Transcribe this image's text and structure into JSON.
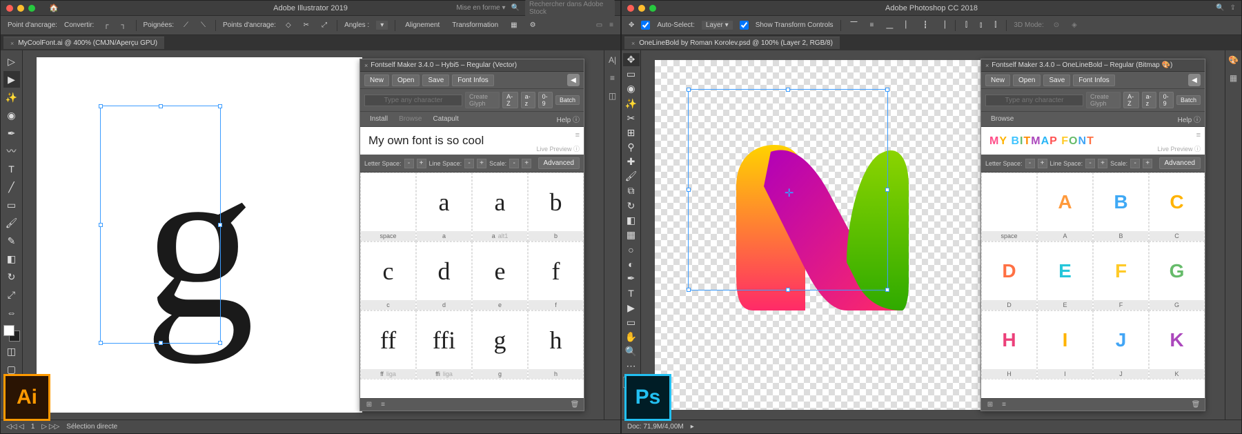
{
  "ai": {
    "app_title": "Adobe Illustrator 2019",
    "layout_label": "Mise en forme ▾",
    "search_placeholder": "Rechercher dans Adobe Stock",
    "options": {
      "anchor": "Point d'ancrage:",
      "convert": "Convertir:",
      "handles": "Poignées:",
      "anchor2": "Points d'ancrage:",
      "angles": "Angles :",
      "align": "Alignement",
      "transform": "Transformation"
    },
    "doc_tab": "MyCoolFont.ai @ 400% (CMJN/Aperçu GPU)",
    "big_glyph": "g",
    "status": {
      "selection": "Sélection directe",
      "page": "1"
    },
    "badge": "Ai"
  },
  "ps": {
    "app_title": "Adobe Photoshop CC 2018",
    "options": {
      "auto_select": "Auto-Select:",
      "layer": "Layer",
      "show_transform": "Show Transform Controls",
      "mode3d": "3D Mode:"
    },
    "doc_tab": "OneLineBold by Roman Korolev.psd @ 100% (Layer 2, RGB/8)",
    "status": {
      "doc": "Doc: 71,9M/4,00M"
    },
    "badge": "Ps"
  },
  "fontself_ai": {
    "title": "Fontself Maker 3.4.0 – Hybi5 – Regular (Vector)",
    "new": "New",
    "open": "Open",
    "save": "Save",
    "info": "Font Infos",
    "type_ph": "Type any character",
    "create": "Create Glyph",
    "az_u": "A-Z",
    "az_l": "a-z",
    "nums": "0-9",
    "batch": "Batch",
    "install": "Install",
    "browse": "Browse",
    "catapult": "Catapult",
    "help": "Help ⓘ",
    "preview": "My own font is so cool",
    "live": "Live Preview ⓘ",
    "letter": "Letter Space:",
    "line": "Line Space:",
    "scale": "Scale:",
    "adv": "Advanced",
    "rows": [
      [
        {
          "g": "",
          "l": "space"
        },
        {
          "g": "a",
          "l": "a"
        },
        {
          "g": "a",
          "l": "a",
          "s": "alt1"
        },
        {
          "g": "b",
          "l": "b"
        }
      ],
      [
        {
          "g": "c",
          "l": "c"
        },
        {
          "g": "d",
          "l": "d"
        },
        {
          "g": "e",
          "l": "e"
        },
        {
          "g": "f",
          "l": "f"
        }
      ],
      [
        {
          "g": "ff",
          "l": "ff",
          "s": "liga"
        },
        {
          "g": "ffi",
          "l": "ffi",
          "s": "liga"
        },
        {
          "g": "g",
          "l": "g"
        },
        {
          "g": "h",
          "l": "h"
        }
      ]
    ]
  },
  "fontself_ps": {
    "title": "Fontself Maker 3.4.0 – OneLineBold – Regular (Bitmap 🎨)",
    "new": "New",
    "open": "Open",
    "save": "Save",
    "info": "Font Infos",
    "type_ph": "Type any character",
    "create": "Create Glyph",
    "az_u": "A-Z",
    "az_l": "a-z",
    "nums": "0-9",
    "batch": "Batch",
    "browse": "Browse",
    "help": "Help ⓘ",
    "preview": "MY BITMAP FONT",
    "live": "Live Preview ⓘ",
    "letter": "Letter Space:",
    "line": "Line Space:",
    "scale": "Scale:",
    "adv": "Advanced",
    "rows": [
      [
        {
          "g": "",
          "l": "space"
        },
        {
          "g": "A",
          "l": "A",
          "c": "#ff9a3c"
        },
        {
          "g": "B",
          "l": "B",
          "c": "#3fa9f5"
        },
        {
          "g": "C",
          "l": "C",
          "c": "#ffb300"
        }
      ],
      [
        {
          "g": "D",
          "l": "D",
          "c": "#ff7043"
        },
        {
          "g": "E",
          "l": "E",
          "c": "#26c6da"
        },
        {
          "g": "F",
          "l": "F",
          "c": "#ffca28"
        },
        {
          "g": "G",
          "l": "G",
          "c": "#66bb6a"
        }
      ],
      [
        {
          "g": "H",
          "l": "H",
          "c": "#ec407a"
        },
        {
          "g": "I",
          "l": "I",
          "c": "#ffb300"
        },
        {
          "g": "J",
          "l": "J",
          "c": "#42a5f5"
        },
        {
          "g": "K",
          "l": "K",
          "c": "#ab47bc"
        }
      ]
    ]
  }
}
